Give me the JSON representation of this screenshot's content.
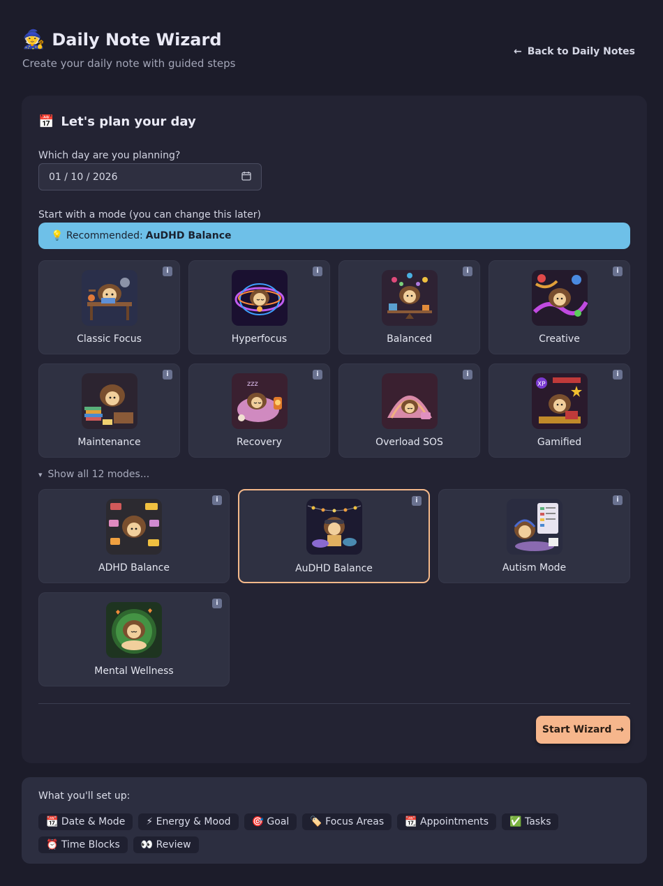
{
  "header": {
    "title_emoji": "🧙",
    "title": "Daily Note Wizard",
    "subtitle": "Create your daily note with guided steps",
    "back_arrow": "←",
    "back_label": "Back to Daily Notes"
  },
  "planner": {
    "heading_emoji": "📅",
    "heading": "Let's plan your day",
    "date_label": "Which day are you planning?",
    "date_value": "01 / 10 / 2026",
    "mode_label": "Start with a mode (you can change this later)",
    "recommend_prefix": "💡 Recommended:",
    "recommend_mode": "AuDHD Balance",
    "show_all": "Show all 12 modes...",
    "show_all_caret": "▾",
    "start_label": "Start Wizard",
    "start_arrow": "→"
  },
  "modes": [
    {
      "name": "Classic Focus",
      "icon": "hedgehog-desk-icon"
    },
    {
      "name": "Hyperfocus",
      "icon": "hedgehog-swirl-icon"
    },
    {
      "name": "Balanced",
      "icon": "hedgehog-juggle-icon"
    },
    {
      "name": "Creative",
      "icon": "hedgehog-paint-icon"
    },
    {
      "name": "Maintenance",
      "icon": "hedgehog-books-icon"
    },
    {
      "name": "Recovery",
      "icon": "hedgehog-sleep-icon"
    },
    {
      "name": "Overload SOS",
      "icon": "hedgehog-blanket-icon"
    },
    {
      "name": "Gamified",
      "icon": "hedgehog-levelup-icon"
    },
    {
      "name": "ADHD Balance",
      "icon": "hedgehog-notes-icon"
    },
    {
      "name": "AuDHD Balance",
      "icon": "hedgehog-lights-icon",
      "selected": true
    },
    {
      "name": "Autism Mode",
      "icon": "hedgehog-schedule-icon"
    },
    {
      "name": "Mental Wellness",
      "icon": "hedgehog-meditate-icon"
    }
  ],
  "info_glyph": "i",
  "setup": {
    "title": "What you'll set up:",
    "chips": [
      "📆 Date & Mode",
      "⚡ Energy & Mood",
      "🎯 Goal",
      "🏷️ Focus Areas",
      "📆 Appointments",
      "✅ Tasks",
      "⏰ Time Blocks",
      "👀 Review"
    ]
  },
  "colors": {
    "background": "#1c1c2a",
    "card": "#232333",
    "accent": "#f6b68c",
    "recommend": "#6ec0e8"
  }
}
